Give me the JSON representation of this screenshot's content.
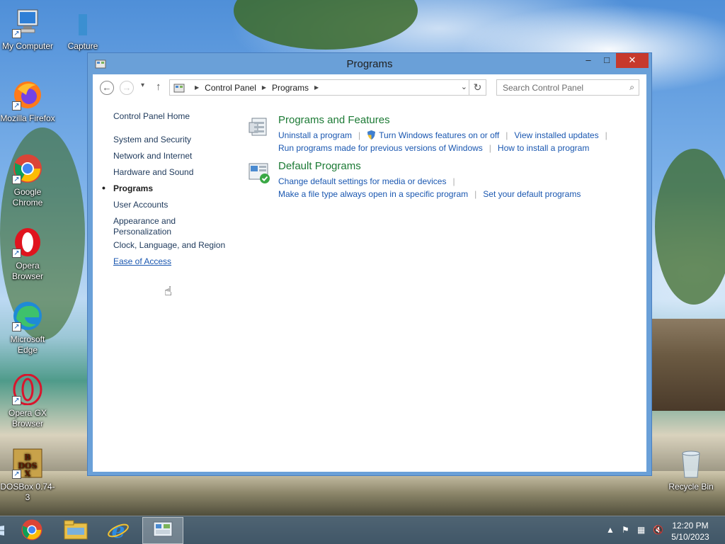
{
  "desktop": {
    "icons": [
      {
        "label": "My Computer",
        "icon": "computer-icon"
      },
      {
        "label": "Capture",
        "icon": "file-icon"
      },
      {
        "label": "Mozilla Firefox",
        "icon": "firefox-icon"
      },
      {
        "label": "Google Chrome",
        "icon": "chrome-icon"
      },
      {
        "label": "Opera Browser",
        "icon": "opera-icon"
      },
      {
        "label": "Microsoft Edge",
        "icon": "edge-icon"
      },
      {
        "label": "Opera GX Browser",
        "icon": "opera-gx-icon"
      },
      {
        "label": "DOSBox 0.74-3",
        "icon": "dosbox-icon"
      },
      {
        "label": "Recycle Bin",
        "icon": "recycle-bin-icon"
      }
    ]
  },
  "window": {
    "title": "Programs",
    "controls": {
      "minimize": "–",
      "maximize": "□",
      "close": "✕"
    },
    "address": {
      "crumbs": [
        "Control Panel",
        "Programs"
      ],
      "search_placeholder": "Search Control Panel"
    },
    "left_nav": {
      "home": "Control Panel Home",
      "items": [
        "System and Security",
        "Network and Internet",
        "Hardware and Sound",
        "Programs",
        "User Accounts",
        "Appearance and Personalization",
        "Clock, Language, and Region",
        "Ease of Access"
      ],
      "current": "Programs"
    },
    "sections": [
      {
        "title": "Programs and Features",
        "icon": "programs-features-icon",
        "links": [
          "Uninstall a program",
          "Turn Windows features on or off",
          "View installed updates",
          "Run programs made for previous versions of Windows",
          "How to install a program"
        ]
      },
      {
        "title": "Default Programs",
        "icon": "default-programs-icon",
        "links": [
          "Change default settings for media or devices",
          "Make a file type always open in a specific program",
          "Set your default programs"
        ]
      }
    ]
  },
  "taskbar": {
    "pinned": [
      "chrome-icon",
      "file-explorer-icon",
      "internet-explorer-icon",
      "control-panel-icon"
    ],
    "clock": {
      "time": "12:20 PM",
      "date": "5/10/2023"
    }
  }
}
